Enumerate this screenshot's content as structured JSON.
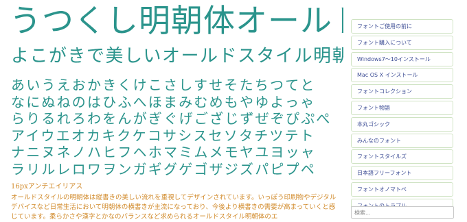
{
  "page": {
    "title": "うつくし明朝体オールド",
    "subtitle": "よこがきで美しいオールドスタイル明朝体"
  },
  "sample": {
    "rows": [
      "あいうえおかきくけこさしすせそたちつてと",
      "なにぬねのはひふへほまみむめもやゆよっゃ",
      "らりるれろわをんがぎぐげござじずぜぞぴぷぺ",
      "アイウエオカキクケコサシスセソタチツテト",
      "ナニヌネノハヒフヘホマミムメモヤユヨッャ",
      "ラリルレロワヲンガギグゲゴザジズパピプペ"
    ],
    "small_heading": "16pxアンチエイリアス",
    "paragraph": "オールドスタイルの明朝体は縦書きの美しい流れを重視してデザインされています。いっぽう印刷物やデジタルデバイスなど日常生活において明朝体の横書きが主流になっており、今後より横書きの需要が高まっていくと感じています。柔らかさや漢字とかなのバランスなど求められるオールドスタイル明朝体のエ"
  },
  "sidebar": {
    "items": [
      {
        "label": "フォントご使用の前に"
      },
      {
        "label": "フォント購入について"
      },
      {
        "label": "Windows7〜10インストール"
      },
      {
        "label": "Mac OS X インストール"
      },
      {
        "label": "フォントコレクション"
      },
      {
        "label": "フォント物語"
      },
      {
        "label": "本丸ゴシック"
      },
      {
        "label": "みんなのフォント"
      },
      {
        "label": "フォントスタイルズ"
      },
      {
        "label": "日本語フリーフォント"
      },
      {
        "label": "フォントオノマトペ"
      },
      {
        "label": "フォントのトラブル"
      }
    ]
  },
  "search": {
    "placeholder": "検索..."
  },
  "colors": {
    "accent_teal": "#2b948c",
    "body_orange": "#d18a2a",
    "link_navy": "#3f4f96",
    "menu_border": "#cfe3c3"
  }
}
